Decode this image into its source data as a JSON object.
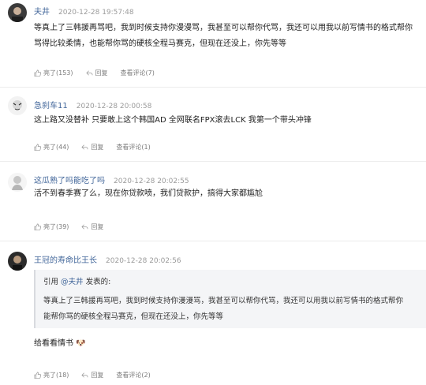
{
  "comments": [
    {
      "user": "夫井",
      "time": "2020-12-28 19:57:48",
      "text_lines": [
        "等真上了三韩援再骂吧，我到时候支持你漫漫骂，我甚至可以帮你代骂，我还可以用我以前写情书的格式帮你",
        "骂得比较柔情，也能帮你骂的硬核全程马赛克，但现在还没上，你先等等"
      ],
      "like_label": "亮了(153)",
      "reply_label": "回复",
      "view_label": "查看评论(7)"
    },
    {
      "user": "急刹车11",
      "time": "2020-12-28 20:00:58",
      "text_lines": [
        "这上路又没替补 只要敢上这个韩国AD 全网联名FPX滚去LCK 我第一个带头冲锋"
      ],
      "like_label": "亮了(44)",
      "reply_label": "回复",
      "view_label": "查看评论(1)"
    },
    {
      "user": "这瓜熟了吗能吃了吗",
      "time": "2020-12-28 20:02:55",
      "text_lines": [
        "活不到春季赛了么，现在你贷款喷，我们贷款护，搞得大家都尴尬"
      ],
      "like_label": "亮了(39)",
      "reply_label": "回复"
    },
    {
      "user": "王冠的寿命比王长",
      "time": "2020-12-28 20:02:56",
      "quote": {
        "prefix": "引用 ",
        "mention": "@夫井",
        "suffix": " 发表的:",
        "lines": [
          "等真上了三韩援再骂吧，我到时候支持你漫漫骂，我甚至可以帮你代骂，我还可以用我以前写情书的格式帮你",
          "能帮你骂的硬核全程马赛克，但现在还没上，你先等等"
        ]
      },
      "text_lines": [
        "给看看情书 🐶"
      ],
      "like_label": "亮了(18)",
      "reply_label": "回复",
      "view_label": "查看评论(2)"
    }
  ],
  "colors": {
    "username": "#406599",
    "time": "#9b9b9b",
    "action": "#7a7a7a",
    "quote_bg": "#f4f5f7"
  },
  "icons": {
    "like": "thumb-up-icon",
    "reply": "reply-arrow-icon"
  }
}
